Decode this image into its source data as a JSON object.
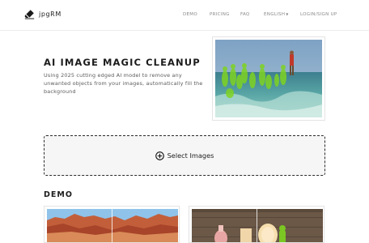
{
  "header": {
    "brand_name": "jpgRM",
    "nav": {
      "demo": "DEMO",
      "pricing": "PRICING",
      "faq": "FAQ",
      "language": "ENGLISH",
      "login": "LOGIN/SIGN UP"
    }
  },
  "hero": {
    "title": "AI IMAGE MAGIC CLEANUP",
    "description": "Using 2025 cutting edged AI model to remove any unwanted objects from your images, automatically fill the background"
  },
  "upload": {
    "label": "Select Images"
  },
  "demo": {
    "title": "DEMO"
  },
  "icons": {
    "brand": "eraser-icon",
    "upload": "plus-circle-icon",
    "language_dropdown": "caret-down-icon"
  }
}
